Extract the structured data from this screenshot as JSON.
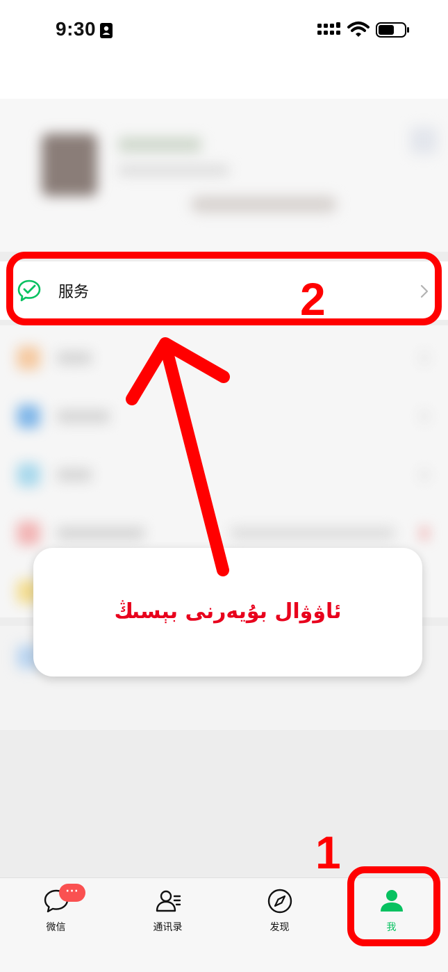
{
  "status_bar": {
    "time": "9:30",
    "icons": [
      "id-card-icon",
      "signal-icon",
      "wifi-icon",
      "battery-icon"
    ]
  },
  "service": {
    "label": "服务",
    "icon": "wechat-pay-icon",
    "color": "#07c160"
  },
  "annotation": {
    "callout_text": "ئاۋۋال بۇيەرنى بېسىڭ",
    "step_service": "2",
    "step_me_tab": "1",
    "color": "#ff0000"
  },
  "tab_bar": {
    "active_color": "#07c160",
    "tabs": [
      {
        "label": "微信",
        "icon": "chat-bubble-icon",
        "badge": "···"
      },
      {
        "label": "通讯录",
        "icon": "contacts-icon"
      },
      {
        "label": "发现",
        "icon": "compass-icon"
      },
      {
        "label": "我",
        "icon": "person-icon",
        "active": true
      }
    ]
  }
}
